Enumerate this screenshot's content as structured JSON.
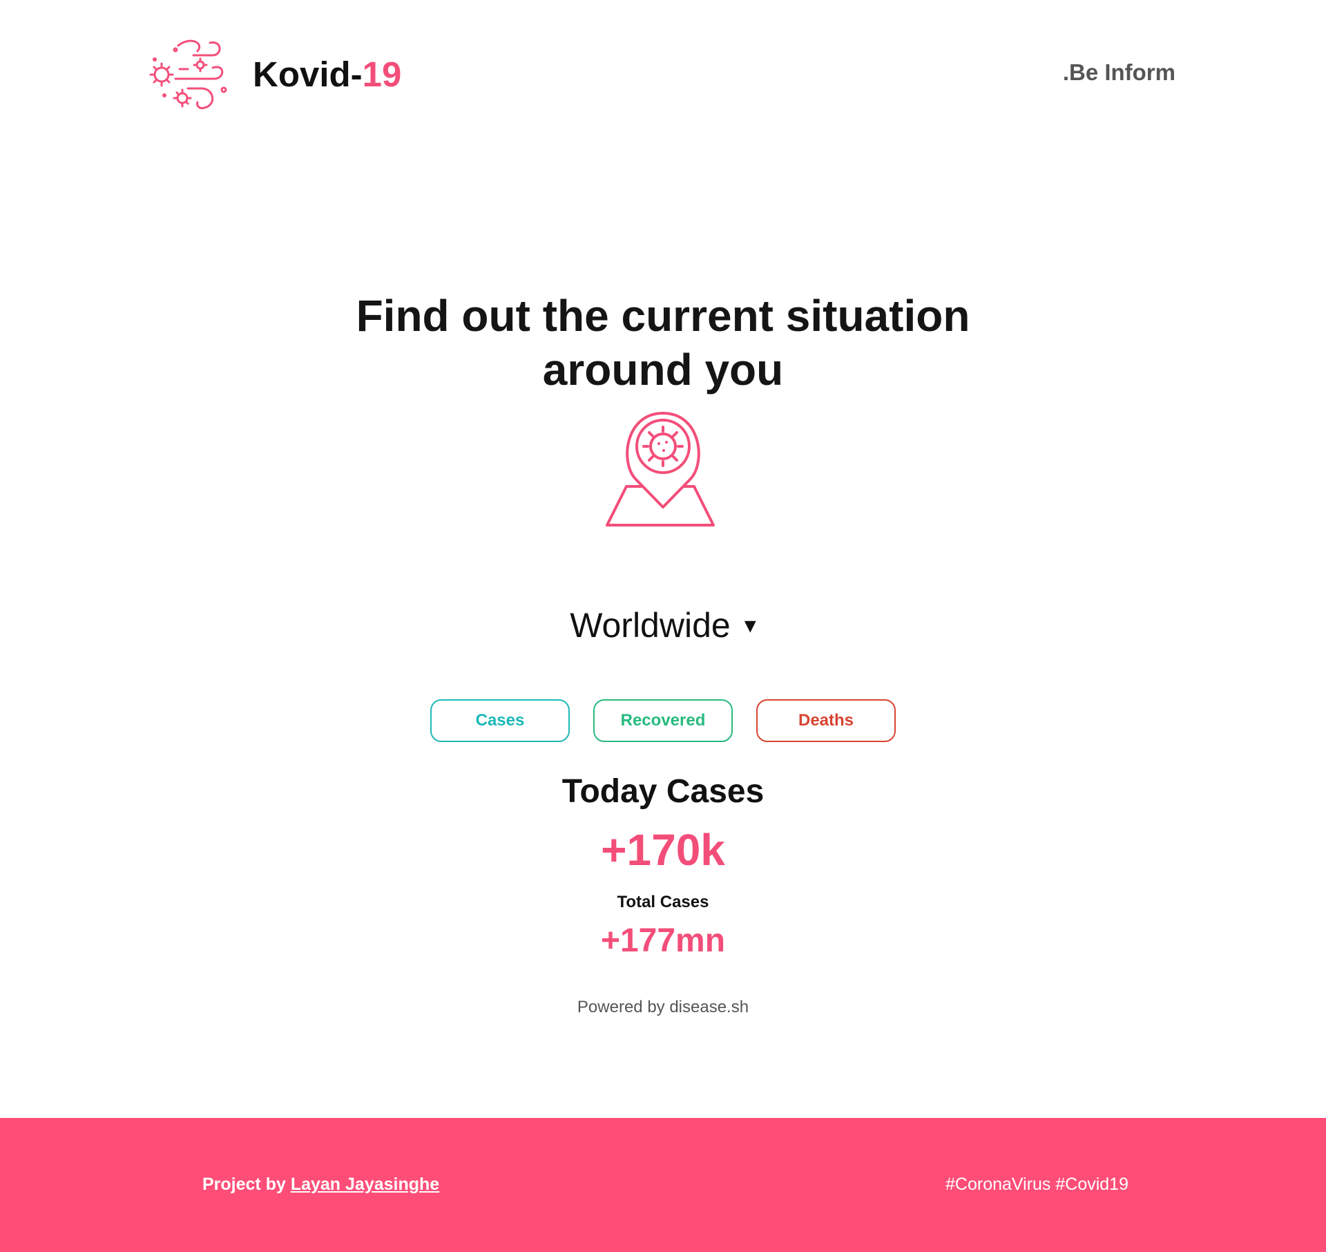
{
  "header": {
    "brand_prefix": "Kovid-",
    "brand_suffix": "19",
    "tagline": ".Be Inform",
    "logo_icon": "virus-wind-icon"
  },
  "hero": {
    "line1": "Find out the current situation",
    "line2": "around you",
    "icon": "virus-map-pin-icon"
  },
  "region": {
    "selected": "Worldwide",
    "caret": "▾"
  },
  "tabs": [
    {
      "label": "Cases",
      "color": "#1db8b8"
    },
    {
      "label": "Recovered",
      "color": "#27ba7f"
    },
    {
      "label": "Deaths",
      "color": "#d84431"
    }
  ],
  "stats": {
    "today_label": "Today Cases",
    "today_value": "+170k",
    "total_label": "Total Cases",
    "total_value": "+177mn"
  },
  "powered_by": "Powered by disease.sh",
  "footer": {
    "prefix": "Project by ",
    "author": "Layan Jayasinghe",
    "hashtags": "#CoronaVirus #Covid19"
  },
  "colors": {
    "accent": "#f34e7a",
    "footer_bg": "#fe4e78"
  }
}
